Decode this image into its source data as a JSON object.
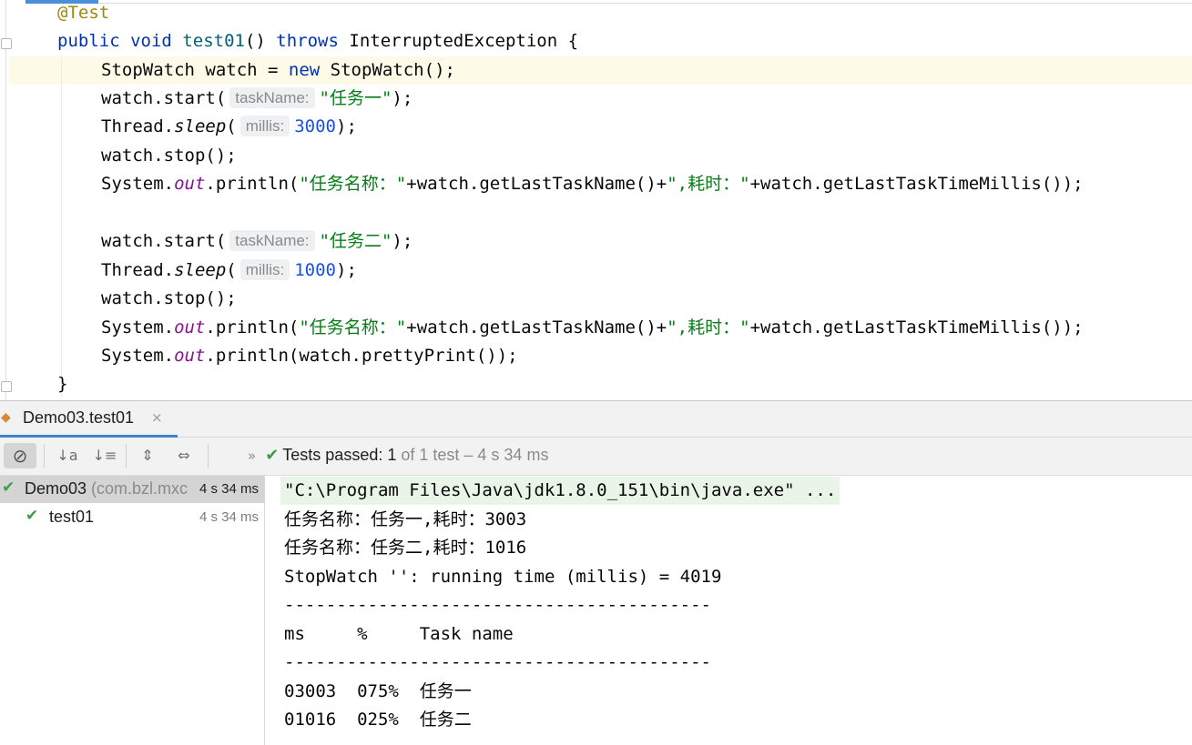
{
  "editor": {
    "lines": {
      "l0_annotation": "@Test",
      "l1_kw_public": "public",
      "l1_kw_void": "void",
      "l1_method": "test01",
      "l1_parens": "()",
      "l1_kw_throws": "throws",
      "l1_exception": "InterruptedException {",
      "l2_type": "StopWatch watch = ",
      "l2_kw_new": "new",
      "l2_ctor": " StopWatch();",
      "l3_call": "watch.start(",
      "l3_hint": "taskName:",
      "l3_arg": "\"任务一\"",
      "l3_end": ");",
      "l4_class": "Thread.",
      "l4_method": "sleep",
      "l4_open": "(",
      "l4_hint": "millis:",
      "l4_arg": "3000",
      "l4_end": ");",
      "l5": "watch.stop();",
      "l6_sys": "System.",
      "l6_out": "out",
      "l6_println": ".println(",
      "l6_s1": "\"任务名称：\"",
      "l6_mid": "+watch.getLastTaskName()+",
      "l6_s2": "\",耗时：\"",
      "l6_end": "+watch.getLastTaskTimeMillis());",
      "l8_call": "watch.start(",
      "l8_hint": "taskName:",
      "l8_arg": "\"任务二\"",
      "l8_end": ");",
      "l9_class": "Thread.",
      "l9_method": "sleep",
      "l9_open": "(",
      "l9_hint": "millis:",
      "l9_arg": "1000",
      "l9_end": ");",
      "l10": "watch.stop();",
      "l11_sys": "System.",
      "l11_out": "out",
      "l11_println": ".println(",
      "l11_s1": "\"任务名称：\"",
      "l11_mid": "+watch.getLastTaskName()+",
      "l11_s2": "\",耗时：\"",
      "l11_end": "+watch.getLastTaskTimeMillis());",
      "l12_sys": "System.",
      "l12_out": "out",
      "l12_rest": ".println(watch.prettyPrint());",
      "l13": "}"
    }
  },
  "run_panel": {
    "tab": {
      "label": "Demo03.test01",
      "close": "×",
      "icon": "run-config-icon"
    },
    "toolbar": {
      "buttons": [
        {
          "name": "stop-icon",
          "glyph": "⊘"
        },
        {
          "name": "sort-alpha-icon",
          "glyph": "↓a"
        },
        {
          "name": "sort-duration-icon",
          "glyph": "↓≡"
        },
        {
          "name": "expand-all-icon",
          "glyph": "⇕"
        },
        {
          "name": "collapse-all-icon",
          "glyph": "⇔"
        }
      ],
      "more": "»"
    },
    "status": {
      "prefix": "Tests passed: ",
      "count": "1",
      "rest": " of 1 test – 4 s 34 ms"
    },
    "tree": [
      {
        "name": "Demo03",
        "pkg": " (com.bzl.mxc",
        "time": "4 s 34 ms",
        "selected": true
      },
      {
        "name": "test01",
        "pkg": "",
        "time": "4 s 34 ms",
        "selected": false
      }
    ],
    "console": [
      "\"C:\\Program Files\\Java\\jdk1.8.0_151\\bin\\java.exe\" ...",
      "任务名称：任务一,耗时：3003",
      "任务名称：任务二,耗时：1016",
      "StopWatch '': running time (millis) = 4019",
      "-----------------------------------------",
      "ms     %     Task name",
      "-----------------------------------------",
      "03003  075%  任务一",
      "01016  025%  任务二"
    ]
  },
  "colors": {
    "keyword": "#0033b3",
    "string": "#067d17",
    "number": "#1750eb",
    "static_field": "#871094",
    "annotation": "#9e880d",
    "pass_green": "#3f9a49",
    "tab_accent": "#4083c9"
  }
}
